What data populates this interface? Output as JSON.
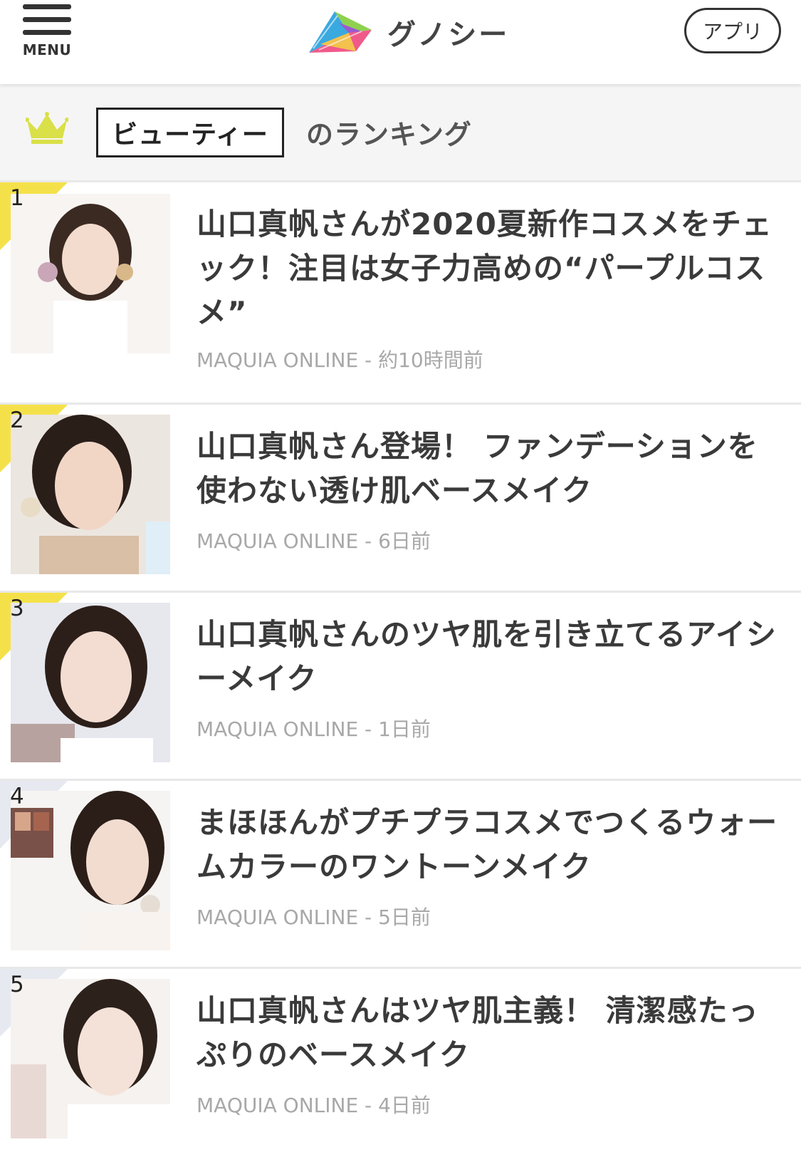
{
  "header": {
    "menu_label": "MENU",
    "brand": "グノシー",
    "app_button": "アプリ"
  },
  "ranking": {
    "category": "ビューティー",
    "suffix": "のランキング"
  },
  "colors": {
    "ribbon_gold": "#f4e14a",
    "ribbon_gray": "#e6e9f0",
    "crown": "#d9e048"
  },
  "items": [
    {
      "rank": "1",
      "title": "山口真帆さんが2020夏新作コスメをチェック！注目は女子力高めの“パープルコスメ”",
      "source": "MAQUIA ONLINE",
      "time": "約10時間前"
    },
    {
      "rank": "2",
      "title": "山口真帆さん登場！ ファンデーションを使わない透け肌ベースメイク",
      "source": "MAQUIA ONLINE",
      "time": "6日前"
    },
    {
      "rank": "3",
      "title": "山口真帆さんのツヤ肌を引き立てるアイシーメイク",
      "source": "MAQUIA ONLINE",
      "time": "1日前"
    },
    {
      "rank": "4",
      "title": "まほほんがプチプラコスメでつくるウォームカラーのワントーンメイク",
      "source": "MAQUIA ONLINE",
      "time": "5日前"
    },
    {
      "rank": "5",
      "title": "山口真帆さんはツヤ肌主義！ 清潔感たっぷりのベースメイク",
      "source": "MAQUIA ONLINE",
      "time": "4日前"
    }
  ]
}
